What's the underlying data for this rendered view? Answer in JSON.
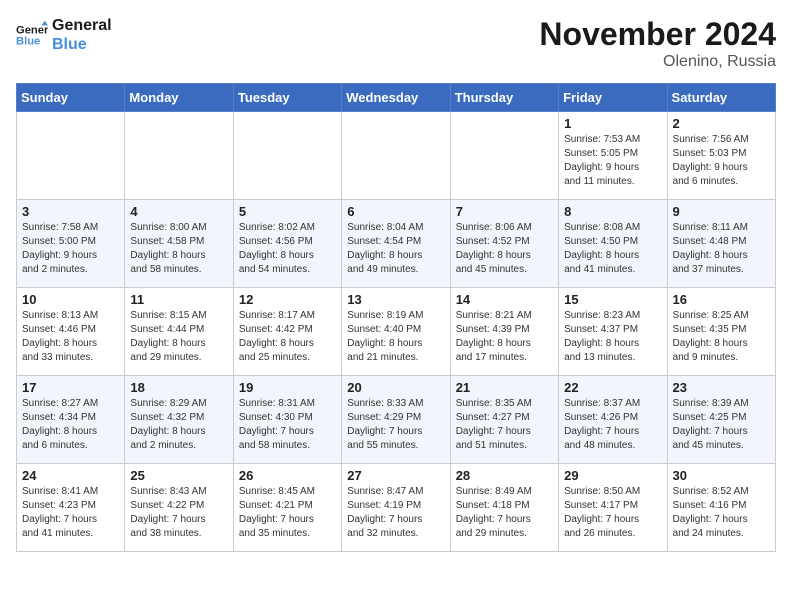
{
  "logo": {
    "line1": "General",
    "line2": "Blue"
  },
  "title": "November 2024",
  "location": "Olenino, Russia",
  "days_of_week": [
    "Sunday",
    "Monday",
    "Tuesday",
    "Wednesday",
    "Thursday",
    "Friday",
    "Saturday"
  ],
  "weeks": [
    [
      {
        "day": "",
        "info": ""
      },
      {
        "day": "",
        "info": ""
      },
      {
        "day": "",
        "info": ""
      },
      {
        "day": "",
        "info": ""
      },
      {
        "day": "",
        "info": ""
      },
      {
        "day": "1",
        "info": "Sunrise: 7:53 AM\nSunset: 5:05 PM\nDaylight: 9 hours\nand 11 minutes."
      },
      {
        "day": "2",
        "info": "Sunrise: 7:56 AM\nSunset: 5:03 PM\nDaylight: 9 hours\nand 6 minutes."
      }
    ],
    [
      {
        "day": "3",
        "info": "Sunrise: 7:58 AM\nSunset: 5:00 PM\nDaylight: 9 hours\nand 2 minutes."
      },
      {
        "day": "4",
        "info": "Sunrise: 8:00 AM\nSunset: 4:58 PM\nDaylight: 8 hours\nand 58 minutes."
      },
      {
        "day": "5",
        "info": "Sunrise: 8:02 AM\nSunset: 4:56 PM\nDaylight: 8 hours\nand 54 minutes."
      },
      {
        "day": "6",
        "info": "Sunrise: 8:04 AM\nSunset: 4:54 PM\nDaylight: 8 hours\nand 49 minutes."
      },
      {
        "day": "7",
        "info": "Sunrise: 8:06 AM\nSunset: 4:52 PM\nDaylight: 8 hours\nand 45 minutes."
      },
      {
        "day": "8",
        "info": "Sunrise: 8:08 AM\nSunset: 4:50 PM\nDaylight: 8 hours\nand 41 minutes."
      },
      {
        "day": "9",
        "info": "Sunrise: 8:11 AM\nSunset: 4:48 PM\nDaylight: 8 hours\nand 37 minutes."
      }
    ],
    [
      {
        "day": "10",
        "info": "Sunrise: 8:13 AM\nSunset: 4:46 PM\nDaylight: 8 hours\nand 33 minutes."
      },
      {
        "day": "11",
        "info": "Sunrise: 8:15 AM\nSunset: 4:44 PM\nDaylight: 8 hours\nand 29 minutes."
      },
      {
        "day": "12",
        "info": "Sunrise: 8:17 AM\nSunset: 4:42 PM\nDaylight: 8 hours\nand 25 minutes."
      },
      {
        "day": "13",
        "info": "Sunrise: 8:19 AM\nSunset: 4:40 PM\nDaylight: 8 hours\nand 21 minutes."
      },
      {
        "day": "14",
        "info": "Sunrise: 8:21 AM\nSunset: 4:39 PM\nDaylight: 8 hours\nand 17 minutes."
      },
      {
        "day": "15",
        "info": "Sunrise: 8:23 AM\nSunset: 4:37 PM\nDaylight: 8 hours\nand 13 minutes."
      },
      {
        "day": "16",
        "info": "Sunrise: 8:25 AM\nSunset: 4:35 PM\nDaylight: 8 hours\nand 9 minutes."
      }
    ],
    [
      {
        "day": "17",
        "info": "Sunrise: 8:27 AM\nSunset: 4:34 PM\nDaylight: 8 hours\nand 6 minutes."
      },
      {
        "day": "18",
        "info": "Sunrise: 8:29 AM\nSunset: 4:32 PM\nDaylight: 8 hours\nand 2 minutes."
      },
      {
        "day": "19",
        "info": "Sunrise: 8:31 AM\nSunset: 4:30 PM\nDaylight: 7 hours\nand 58 minutes."
      },
      {
        "day": "20",
        "info": "Sunrise: 8:33 AM\nSunset: 4:29 PM\nDaylight: 7 hours\nand 55 minutes."
      },
      {
        "day": "21",
        "info": "Sunrise: 8:35 AM\nSunset: 4:27 PM\nDaylight: 7 hours\nand 51 minutes."
      },
      {
        "day": "22",
        "info": "Sunrise: 8:37 AM\nSunset: 4:26 PM\nDaylight: 7 hours\nand 48 minutes."
      },
      {
        "day": "23",
        "info": "Sunrise: 8:39 AM\nSunset: 4:25 PM\nDaylight: 7 hours\nand 45 minutes."
      }
    ],
    [
      {
        "day": "24",
        "info": "Sunrise: 8:41 AM\nSunset: 4:23 PM\nDaylight: 7 hours\nand 41 minutes."
      },
      {
        "day": "25",
        "info": "Sunrise: 8:43 AM\nSunset: 4:22 PM\nDaylight: 7 hours\nand 38 minutes."
      },
      {
        "day": "26",
        "info": "Sunrise: 8:45 AM\nSunset: 4:21 PM\nDaylight: 7 hours\nand 35 minutes."
      },
      {
        "day": "27",
        "info": "Sunrise: 8:47 AM\nSunset: 4:19 PM\nDaylight: 7 hours\nand 32 minutes."
      },
      {
        "day": "28",
        "info": "Sunrise: 8:49 AM\nSunset: 4:18 PM\nDaylight: 7 hours\nand 29 minutes."
      },
      {
        "day": "29",
        "info": "Sunrise: 8:50 AM\nSunset: 4:17 PM\nDaylight: 7 hours\nand 26 minutes."
      },
      {
        "day": "30",
        "info": "Sunrise: 8:52 AM\nSunset: 4:16 PM\nDaylight: 7 hours\nand 24 minutes."
      }
    ]
  ]
}
